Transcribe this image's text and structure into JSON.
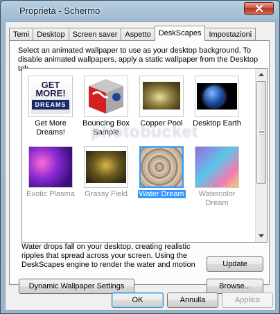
{
  "window": {
    "title": "Proprietà - Schermo"
  },
  "tabs": [
    {
      "label": "Temi"
    },
    {
      "label": "Desktop"
    },
    {
      "label": "Screen saver"
    },
    {
      "label": "Aspetto"
    },
    {
      "label": "DeskScapes",
      "active": true
    },
    {
      "label": "Impostazioni"
    }
  ],
  "panel": {
    "description": "Select an animated wallpaper to use as your desktop background.  To disable animated wallpapers, apply a static wallpaper from the Desktop tab."
  },
  "gallery": {
    "items": [
      {
        "label": "Get More Dreams!",
        "icon": "get-more-dreams-logo"
      },
      {
        "label": "Bouncing Box Sample",
        "icon": "bouncing-box-cube"
      },
      {
        "label": "Copper Pool",
        "icon": "copper-pool-image"
      },
      {
        "label": "Desktop Earth",
        "icon": "earth-image"
      },
      {
        "label": "Exotic Plasma",
        "icon": "plasma-image",
        "dim": true
      },
      {
        "label": "Grassy Field",
        "icon": "grassy-field-image",
        "dim": true
      },
      {
        "label": "Water Dream",
        "icon": "water-image",
        "selected": true
      },
      {
        "label": "Watercolor Dream",
        "icon": "watercolor-image",
        "dim": true
      }
    ],
    "logo_text": {
      "line1": "GET",
      "line2": "MORE!",
      "line3": "DREAMS"
    }
  },
  "info_text": "Water drops fall on your desktop, creating realistic ripples that spread across your screen. Using the DeskScapes engine to render the water and motion",
  "buttons": {
    "update": "Update",
    "dynamic_settings": "Dynamic Wallpaper Settings",
    "browse": "Browse...",
    "ok": "OK",
    "cancel": "Annulla",
    "apply": "Applica"
  },
  "watermark": "photobucket",
  "colors": {
    "selection": "#3399ff",
    "titlebar": "#9db8cf",
    "close": "#c7503a"
  }
}
